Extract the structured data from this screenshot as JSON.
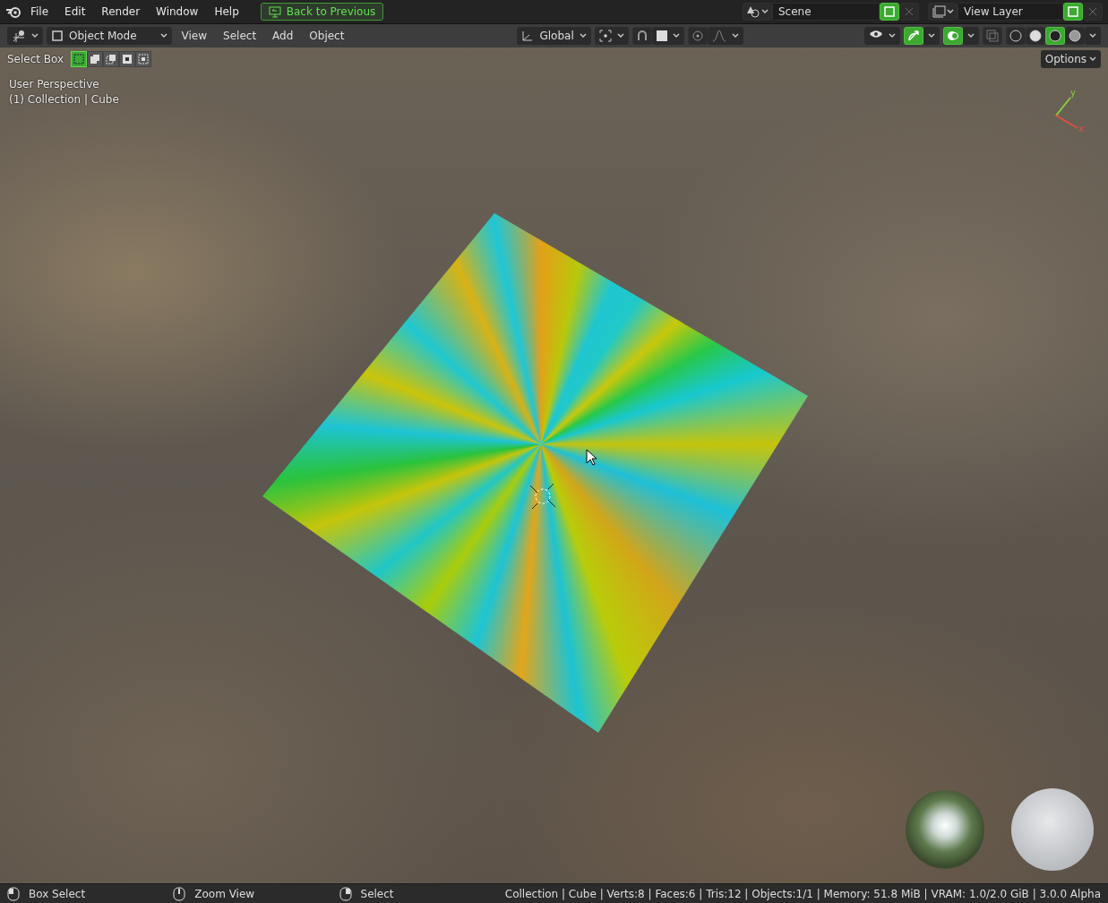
{
  "top_bar": {
    "menus": [
      "File",
      "Edit",
      "Render",
      "Window",
      "Help"
    ],
    "back_button": "Back to Previous",
    "scene": {
      "value": "Scene"
    },
    "view_layer": {
      "value": "View Layer"
    }
  },
  "header": {
    "mode": "Object Mode",
    "menus": [
      "View",
      "Select",
      "Add",
      "Object"
    ],
    "orientation": "Global",
    "toggles": [
      {
        "kind": "snap",
        "on": false
      },
      {
        "kind": "proportional",
        "on": false
      },
      {
        "kind": "gizmo",
        "on": true
      },
      {
        "kind": "overlay",
        "on": true
      },
      {
        "kind": "xray",
        "on": false
      }
    ],
    "shading": [
      {
        "kind": "wireframe",
        "selected": false
      },
      {
        "kind": "solid",
        "selected": false
      },
      {
        "kind": "material",
        "selected": true
      },
      {
        "kind": "rendered",
        "selected": false
      }
    ]
  },
  "tool_settings": {
    "label": "Select Box",
    "modes": [
      {
        "kind": "new",
        "selected": true
      },
      {
        "kind": "extend",
        "selected": false
      },
      {
        "kind": "subtract",
        "selected": false
      },
      {
        "kind": "invert",
        "selected": false
      },
      {
        "kind": "intersect",
        "selected": false
      }
    ],
    "options": "Options"
  },
  "viewport": {
    "view_name": "User Perspective",
    "object_info": "(1) Collection | Cube",
    "gizmo_axes": [
      {
        "label": "y",
        "color": "#8bd13a"
      },
      {
        "label": "x",
        "color": "#e0503e"
      }
    ]
  },
  "status_bar": {
    "hints": [
      {
        "kind": "left",
        "label": "Box Select"
      },
      {
        "kind": "middle",
        "label": "Zoom View"
      },
      {
        "kind": "right",
        "label": "Select"
      }
    ],
    "stats": "Collection | Cube | Verts:8 | Faces:6 | Tris:12 | Objects:1/1 | Memory: 51.8 MiB | VRAM: 1.0/2.0 GiB | 3.0.0 Alpha"
  }
}
